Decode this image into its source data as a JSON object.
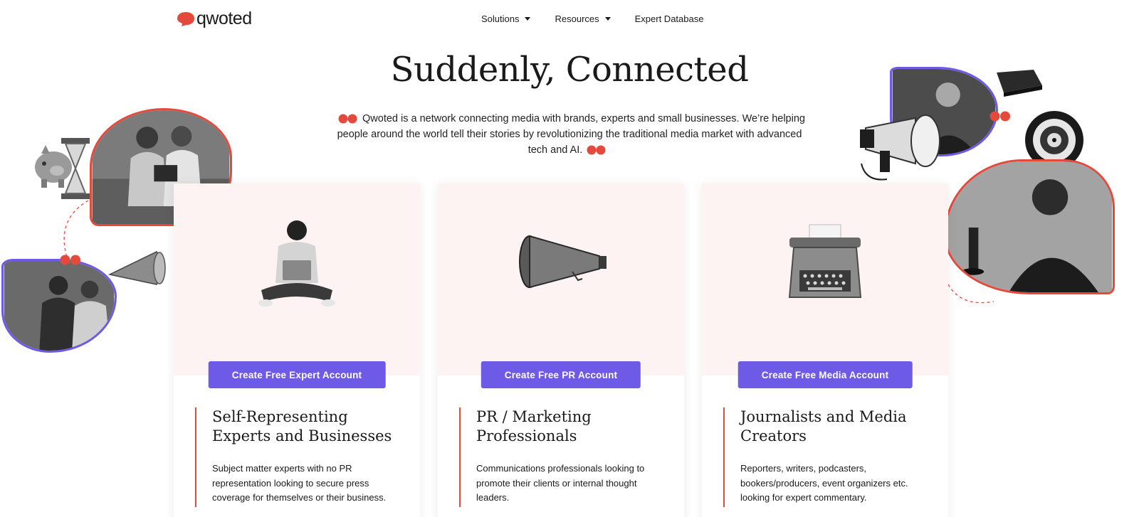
{
  "header": {
    "logo_text": "qwoted",
    "nav": [
      {
        "label": "Solutions",
        "has_dropdown": true
      },
      {
        "label": "Resources",
        "has_dropdown": true
      },
      {
        "label": "Expert Database",
        "has_dropdown": false
      }
    ]
  },
  "hero": {
    "title": "Suddenly, Connected",
    "subtitle": "Qwoted is a network connecting media with brands, experts and small businesses. We’re helping people around the world tell their stories by revolutionizing the traditional media market with advanced tech and AI."
  },
  "cards": [
    {
      "button": "Create Free Expert Account",
      "title": "Self-Representing Experts and Businesses",
      "description": "Subject matter experts with no PR representation looking to secure press coverage for themselves or their business.",
      "illustration": "person-with-laptop"
    },
    {
      "button": "Create Free PR Account",
      "title": "PR / Marketing Professionals",
      "description": "Communications professionals looking to promote their clients or internal thought leaders.",
      "illustration": "megaphone"
    },
    {
      "button": "Create Free Media Account",
      "title": "Journalists and Media Creators",
      "description": "Reporters, writers, podcasters, bookers/producers, event organizers etc. looking for expert commentary.",
      "illustration": "typewriter"
    }
  ],
  "colors": {
    "brand_red": "#e34a3c",
    "brand_purple": "#6d5ae6",
    "card_tint": "#fdf3f2"
  }
}
